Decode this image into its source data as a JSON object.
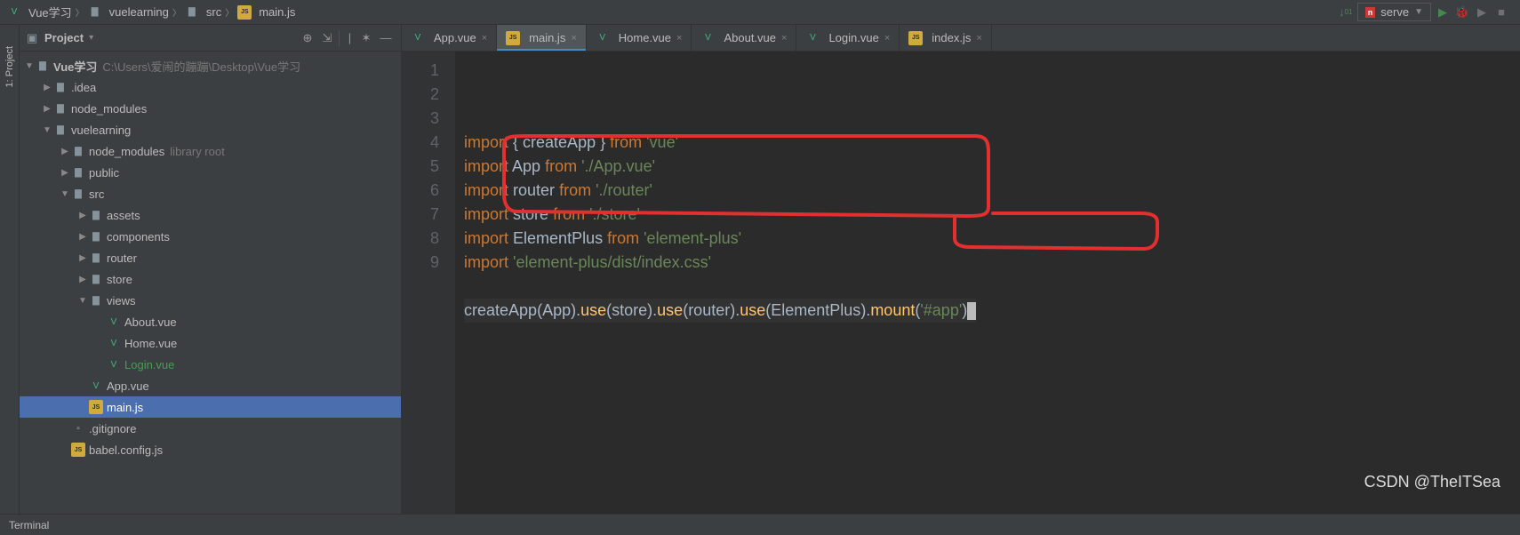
{
  "breadcrumb": [
    {
      "label": "Vue学习",
      "icon": "vue"
    },
    {
      "label": "vuelearning",
      "icon": "folder"
    },
    {
      "label": "src",
      "icon": "folder"
    },
    {
      "label": "main.js",
      "icon": "js"
    }
  ],
  "run_config": {
    "label": "serve",
    "icon": "npm"
  },
  "side_tab_label": "1: Project",
  "panel": {
    "title": "Project",
    "tools": [
      "target",
      "collapse",
      "settings",
      "hide"
    ]
  },
  "tree": {
    "root": "Vue学习",
    "root_hint": "C:\\Users\\爱闹的蹦蹦\\Desktop\\Vue学习",
    "nodes": [
      {
        "label": ".idea",
        "depth": 1,
        "icon": "folder",
        "arrow": "closed"
      },
      {
        "label": "node_modules",
        "depth": 1,
        "icon": "folder",
        "arrow": "closed"
      },
      {
        "label": "vuelearning",
        "depth": 1,
        "icon": "folder",
        "arrow": "open"
      },
      {
        "label": "node_modules",
        "hint": "library root",
        "depth": 2,
        "icon": "folder",
        "arrow": "closed"
      },
      {
        "label": "public",
        "depth": 2,
        "icon": "folder",
        "arrow": "closed"
      },
      {
        "label": "src",
        "depth": 2,
        "icon": "folder",
        "arrow": "open"
      },
      {
        "label": "assets",
        "depth": 3,
        "icon": "folder",
        "arrow": "closed"
      },
      {
        "label": "components",
        "depth": 3,
        "icon": "folder",
        "arrow": "closed"
      },
      {
        "label": "router",
        "depth": 3,
        "icon": "folder",
        "arrow": "closed"
      },
      {
        "label": "store",
        "depth": 3,
        "icon": "folder",
        "arrow": "closed"
      },
      {
        "label": "views",
        "depth": 3,
        "icon": "folder",
        "arrow": "open"
      },
      {
        "label": "About.vue",
        "depth": 4,
        "icon": "vue"
      },
      {
        "label": "Home.vue",
        "depth": 4,
        "icon": "vue"
      },
      {
        "label": "Login.vue",
        "depth": 4,
        "icon": "vue",
        "highlight": "green"
      },
      {
        "label": "App.vue",
        "depth": 3,
        "icon": "vue"
      },
      {
        "label": "main.js",
        "depth": 3,
        "icon": "js",
        "selected": true
      },
      {
        "label": ".gitignore",
        "depth": 2,
        "icon": "file"
      },
      {
        "label": "babel.config.js",
        "depth": 2,
        "icon": "js"
      }
    ]
  },
  "tabs": [
    {
      "label": "App.vue",
      "icon": "vue",
      "active": false
    },
    {
      "label": "main.js",
      "icon": "js",
      "active": true
    },
    {
      "label": "Home.vue",
      "icon": "vue",
      "active": false
    },
    {
      "label": "About.vue",
      "icon": "vue",
      "active": false
    },
    {
      "label": "Login.vue",
      "icon": "vue",
      "active": false
    },
    {
      "label": "index.js",
      "icon": "js",
      "active": false
    }
  ],
  "code_lines": [
    {
      "n": 1,
      "tokens": [
        {
          "t": "kw",
          "v": "import"
        },
        {
          "t": "punct",
          "v": " { "
        },
        {
          "t": "ident",
          "v": "createApp"
        },
        {
          "t": "punct",
          "v": " } "
        },
        {
          "t": "kw",
          "v": "from"
        },
        {
          "t": "punct",
          "v": " "
        },
        {
          "t": "str",
          "v": "'vue'"
        }
      ]
    },
    {
      "n": 2,
      "tokens": [
        {
          "t": "kw",
          "v": "import"
        },
        {
          "t": "punct",
          "v": " "
        },
        {
          "t": "ident",
          "v": "App"
        },
        {
          "t": "punct",
          "v": " "
        },
        {
          "t": "kw",
          "v": "from"
        },
        {
          "t": "punct",
          "v": " "
        },
        {
          "t": "str",
          "v": "'./App.vue'"
        }
      ]
    },
    {
      "n": 3,
      "tokens": [
        {
          "t": "kw",
          "v": "import"
        },
        {
          "t": "punct",
          "v": " "
        },
        {
          "t": "ident",
          "v": "router"
        },
        {
          "t": "punct",
          "v": " "
        },
        {
          "t": "kw",
          "v": "from"
        },
        {
          "t": "punct",
          "v": " "
        },
        {
          "t": "str",
          "v": "'./router'"
        }
      ]
    },
    {
      "n": 4,
      "tokens": [
        {
          "t": "kw",
          "v": "import"
        },
        {
          "t": "punct",
          "v": " "
        },
        {
          "t": "ident",
          "v": "store"
        },
        {
          "t": "punct",
          "v": " "
        },
        {
          "t": "kw",
          "v": "from"
        },
        {
          "t": "punct",
          "v": " "
        },
        {
          "t": "str",
          "v": "'./store'"
        }
      ]
    },
    {
      "n": 5,
      "tokens": [
        {
          "t": "kw",
          "v": "import"
        },
        {
          "t": "punct",
          "v": " "
        },
        {
          "t": "ident",
          "v": "ElementPlus"
        },
        {
          "t": "punct",
          "v": " "
        },
        {
          "t": "kw",
          "v": "from"
        },
        {
          "t": "punct",
          "v": " "
        },
        {
          "t": "str",
          "v": "'element-plus'"
        }
      ]
    },
    {
      "n": 6,
      "tokens": [
        {
          "t": "kw",
          "v": "import"
        },
        {
          "t": "punct",
          "v": " "
        },
        {
          "t": "str",
          "v": "'element-plus/dist/index.css'"
        }
      ]
    },
    {
      "n": 7,
      "tokens": []
    },
    {
      "n": 8,
      "caret": true,
      "tokens": [
        {
          "t": "ident",
          "v": "createApp"
        },
        {
          "t": "punct",
          "v": "("
        },
        {
          "t": "ident",
          "v": "App"
        },
        {
          "t": "punct",
          "v": ")."
        },
        {
          "t": "method",
          "v": "use"
        },
        {
          "t": "punct",
          "v": "("
        },
        {
          "t": "ident",
          "v": "store"
        },
        {
          "t": "punct",
          "v": ")."
        },
        {
          "t": "method",
          "v": "use"
        },
        {
          "t": "punct",
          "v": "("
        },
        {
          "t": "ident",
          "v": "router"
        },
        {
          "t": "punct",
          "v": ")."
        },
        {
          "t": "method",
          "v": "use"
        },
        {
          "t": "punct",
          "v": "("
        },
        {
          "t": "ident",
          "v": "ElementPlus"
        },
        {
          "t": "punct",
          "v": ")."
        },
        {
          "t": "method",
          "v": "mount"
        },
        {
          "t": "punct",
          "v": "("
        },
        {
          "t": "str",
          "v": "'#app'"
        },
        {
          "t": "punct",
          "v": ")"
        }
      ]
    },
    {
      "n": 9,
      "tokens": []
    }
  ],
  "watermark": "CSDN @TheITSea",
  "status_bar": {
    "label": "Terminal"
  }
}
